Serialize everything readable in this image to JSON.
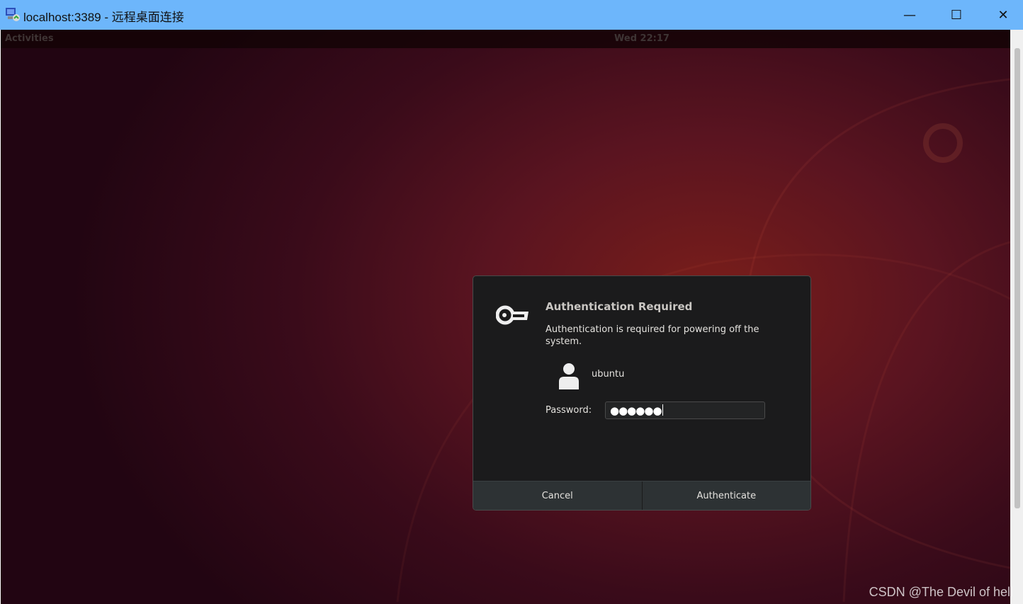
{
  "window": {
    "title": "localhost:3389 - 远程桌面连接",
    "minimize": "—",
    "maximize": "☐",
    "close": "✕"
  },
  "topbar": {
    "activities": "Activities",
    "clock": "Wed 22:17"
  },
  "dialog": {
    "icon": "key-icon",
    "title": "Authentication Required",
    "message": "Authentication is required for powering off the system.",
    "user": "ubuntu",
    "password_label": "Password:",
    "password_value": "●●●●●●",
    "cancel": "Cancel",
    "authenticate": "Authenticate"
  },
  "watermark": "CSDN @The Devil of hell"
}
